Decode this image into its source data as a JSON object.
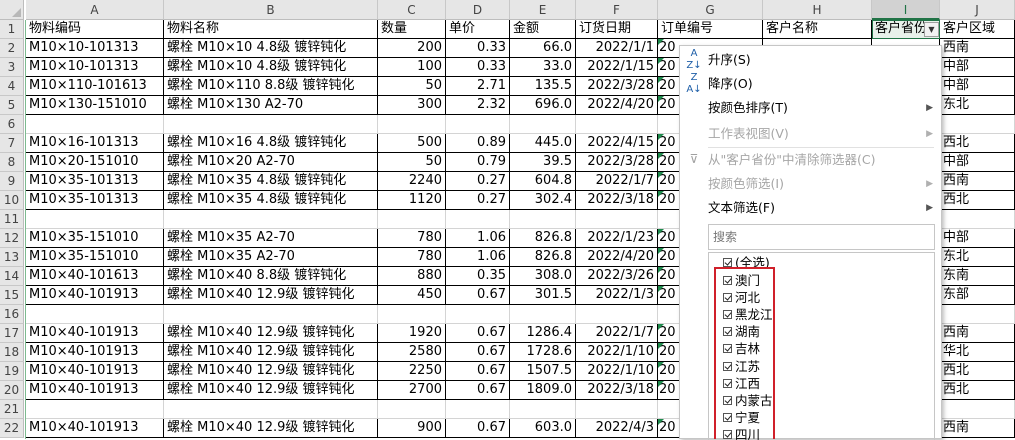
{
  "columns": [
    "A",
    "B",
    "C",
    "D",
    "E",
    "F",
    "G",
    "H",
    "I",
    "J"
  ],
  "selected_column": "I",
  "row_numbers": [
    "1",
    "2",
    "3",
    "4",
    "5",
    "6",
    "7",
    "8",
    "9",
    "10",
    "11",
    "12",
    "13",
    "14",
    "15",
    "16",
    "17",
    "18",
    "19",
    "20",
    "21",
    "22"
  ],
  "headers": {
    "A": "物料编码",
    "B": "物料名称",
    "C": "数量",
    "D": "单价",
    "E": "金额",
    "F": "订货日期",
    "G": "订单编号",
    "H": "客户名称",
    "I": "客户省份",
    "J": "客户区域"
  },
  "rows": [
    {
      "A": "M10×10-101313",
      "B": "螺栓 M10×10  4.8级 镀锌钝化",
      "C": "200",
      "D": "0.33",
      "E": "66.0",
      "F": "2022/1/1",
      "G": "20",
      "J": "西南"
    },
    {
      "A": "M10×10-101313",
      "B": "螺栓 M10×10  4.8级 镀锌钝化",
      "C": "100",
      "D": "0.33",
      "E": "33.0",
      "F": "2022/1/15",
      "G": "20",
      "J": "中部"
    },
    {
      "A": "M10×110-101613",
      "B": "螺栓 M10×110  8.8级 镀锌钝化",
      "C": "50",
      "D": "2.71",
      "E": "135.5",
      "F": "2022/3/28",
      "G": "20",
      "J": "中部"
    },
    {
      "A": "M10×130-151010",
      "B": "螺栓 M10×130 A2-70",
      "C": "300",
      "D": "2.32",
      "E": "696.0",
      "F": "2022/4/20",
      "G": "20",
      "J": "东北"
    },
    {},
    {
      "A": "M10×16-101313",
      "B": "螺栓 M10×16  4.8级 镀锌钝化",
      "C": "500",
      "D": "0.89",
      "E": "445.0",
      "F": "2022/4/15",
      "G": "20",
      "J": "西北"
    },
    {
      "A": "M10×20-151010",
      "B": "螺栓 M10×20 A2-70",
      "C": "50",
      "D": "0.79",
      "E": "39.5",
      "F": "2022/3/28",
      "G": "20",
      "J": "中部"
    },
    {
      "A": "M10×35-101313",
      "B": "螺栓 M10×35  4.8级 镀锌钝化",
      "C": "2240",
      "D": "0.27",
      "E": "604.8",
      "F": "2022/1/7",
      "G": "20",
      "J": "西南"
    },
    {
      "A": "M10×35-101313",
      "B": "螺栓 M10×35  4.8级 镀锌钝化",
      "C": "1120",
      "D": "0.27",
      "E": "302.4",
      "F": "2022/3/18",
      "G": "20",
      "J": "西北"
    },
    {},
    {
      "A": "M10×35-151010",
      "B": "螺栓 M10×35 A2-70",
      "C": "780",
      "D": "1.06",
      "E": "826.8",
      "F": "2022/1/23",
      "G": "20",
      "J": "中部"
    },
    {
      "A": "M10×35-151010",
      "B": "螺栓 M10×35 A2-70",
      "C": "780",
      "D": "1.06",
      "E": "826.8",
      "F": "2022/4/20",
      "G": "20",
      "J": "东北"
    },
    {
      "A": "M10×40-101613",
      "B": "螺栓 M10×40  8.8级 镀锌钝化",
      "C": "880",
      "D": "0.35",
      "E": "308.0",
      "F": "2022/3/26",
      "G": "20",
      "J": "东南"
    },
    {
      "A": "M10×40-101913",
      "B": "螺栓 M10×40  12.9级 镀锌钝化",
      "C": "450",
      "D": "0.67",
      "E": "301.5",
      "F": "2022/1/3",
      "G": "20",
      "J": "东部"
    },
    {},
    {
      "A": "M10×40-101913",
      "B": "螺栓 M10×40  12.9级 镀锌钝化",
      "C": "1920",
      "D": "0.67",
      "E": "1286.4",
      "F": "2022/1/7",
      "G": "20",
      "J": "西南"
    },
    {
      "A": "M10×40-101913",
      "B": "螺栓 M10×40  12.9级 镀锌钝化",
      "C": "2580",
      "D": "0.67",
      "E": "1728.6",
      "F": "2022/1/10",
      "G": "20",
      "J": "华北"
    },
    {
      "A": "M10×40-101913",
      "B": "螺栓 M10×40  12.9级 镀锌钝化",
      "C": "2250",
      "D": "0.67",
      "E": "1507.5",
      "F": "2022/1/10",
      "G": "20",
      "J": "西北"
    },
    {
      "A": "M10×40-101913",
      "B": "螺栓 M10×40  12.9级 镀锌钝化",
      "C": "2700",
      "D": "0.67",
      "E": "1809.0",
      "F": "2022/3/18",
      "G": "20",
      "J": "西北"
    },
    {},
    {
      "A": "M10×40-101913",
      "B": "螺栓 M10×40  12.9级 镀锌钝化",
      "C": "900",
      "D": "0.67",
      "E": "603.0",
      "F": "2022/4/3",
      "G": "20",
      "J": "西南"
    }
  ],
  "filter_menu": {
    "sort_asc": "升序(S)",
    "sort_desc": "降序(O)",
    "sort_by_color": "按颜色排序(T)",
    "sheet_view": "工作表视图(V)",
    "clear_filter": "从\"客户省份\"中清除筛选器(C)",
    "filter_by_color": "按颜色筛选(I)",
    "text_filter": "文本筛选(F)",
    "search_placeholder": "搜索",
    "select_all": "(全选)",
    "values": [
      "澳门",
      "河北",
      "黑龙江",
      "湖南",
      "吉林",
      "江苏",
      "江西",
      "内蒙古",
      "宁夏",
      "四川"
    ]
  },
  "accent_color": "#217346",
  "highlight_color": "#d0202a"
}
